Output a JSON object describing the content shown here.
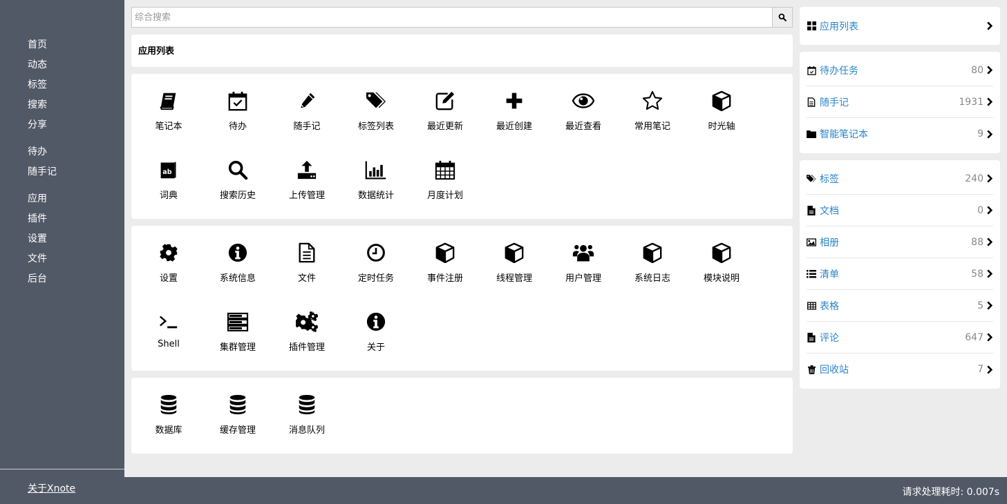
{
  "sidebar": {
    "groups": [
      [
        {
          "label": "首页"
        },
        {
          "label": "动态"
        },
        {
          "label": "标签"
        },
        {
          "label": "搜索"
        },
        {
          "label": "分享"
        }
      ],
      [
        {
          "label": "待办"
        },
        {
          "label": "随手记"
        }
      ],
      [
        {
          "label": "应用"
        },
        {
          "label": "插件"
        },
        {
          "label": "设置"
        },
        {
          "label": "文件"
        },
        {
          "label": "后台"
        }
      ]
    ],
    "about_link": "关于Xnote"
  },
  "search": {
    "placeholder": "综合搜索",
    "value": "",
    "button_icon": "search-icon"
  },
  "main": {
    "title": "应用列表",
    "sections": [
      {
        "apps": [
          {
            "label": "笔记本",
            "icon": "book-icon"
          },
          {
            "label": "待办",
            "icon": "calendar-check-icon"
          },
          {
            "label": "随手记",
            "icon": "pencil-icon"
          },
          {
            "label": "标签列表",
            "icon": "tags-icon"
          },
          {
            "label": "最近更新",
            "icon": "edit-icon"
          },
          {
            "label": "最近创建",
            "icon": "plus-icon"
          },
          {
            "label": "最近查看",
            "icon": "eye-icon"
          },
          {
            "label": "常用笔记",
            "icon": "star-icon"
          },
          {
            "label": "时光轴",
            "icon": "cube-icon"
          },
          {
            "label": "词典",
            "icon": "dictionary-icon"
          },
          {
            "label": "搜索历史",
            "icon": "search-icon"
          },
          {
            "label": "上传管理",
            "icon": "upload-icon"
          },
          {
            "label": "数据统计",
            "icon": "bar-chart-icon"
          },
          {
            "label": "月度计划",
            "icon": "calendar-icon"
          }
        ]
      },
      {
        "apps": [
          {
            "label": "设置",
            "icon": "gear-icon"
          },
          {
            "label": "系统信息",
            "icon": "info-icon"
          },
          {
            "label": "文件",
            "icon": "file-icon"
          },
          {
            "label": "定时任务",
            "icon": "clock-icon"
          },
          {
            "label": "事件注册",
            "icon": "cube-icon"
          },
          {
            "label": "线程管理",
            "icon": "cube-icon"
          },
          {
            "label": "用户管理",
            "icon": "users-icon"
          },
          {
            "label": "系统日志",
            "icon": "cube-icon"
          },
          {
            "label": "模块说明",
            "icon": "cube-icon"
          },
          {
            "label": "Shell",
            "icon": "terminal-icon"
          },
          {
            "label": "集群管理",
            "icon": "server-icon"
          },
          {
            "label": "插件管理",
            "icon": "gears-icon"
          },
          {
            "label": "关于",
            "icon": "info-icon"
          }
        ]
      },
      {
        "apps": [
          {
            "label": "数据库",
            "icon": "database-icon"
          },
          {
            "label": "缓存管理",
            "icon": "database-icon"
          },
          {
            "label": "消息队列",
            "icon": "database-icon"
          }
        ]
      }
    ]
  },
  "right_panel": {
    "app_list": {
      "label": "应用列表",
      "icon": "grid-icon"
    },
    "group1": [
      {
        "label": "待办任务",
        "count": "80",
        "icon": "calendar-check-icon"
      },
      {
        "label": "随手记",
        "count": "1931",
        "icon": "file-text-icon"
      },
      {
        "label": "智能笔记本",
        "count": "9",
        "icon": "folder-icon"
      }
    ],
    "group2": [
      {
        "label": "标签",
        "count": "240",
        "icon": "tags-icon"
      },
      {
        "label": "文档",
        "count": "0",
        "icon": "file-solid-icon"
      },
      {
        "label": "相册",
        "count": "88",
        "icon": "image-icon"
      },
      {
        "label": "清单",
        "count": "58",
        "icon": "list-icon"
      },
      {
        "label": "表格",
        "count": "5",
        "icon": "table-icon"
      },
      {
        "label": "评论",
        "count": "647",
        "icon": "file-solid-icon"
      },
      {
        "label": "回收站",
        "count": "7",
        "icon": "trash-icon"
      }
    ]
  },
  "footer": {
    "timing": "请求处理耗时: 0.007s"
  },
  "colors": {
    "sidebar_bg": "#525966",
    "page_bg": "#ececec",
    "link_blue": "#2a85c8",
    "count_gray": "#888888"
  }
}
